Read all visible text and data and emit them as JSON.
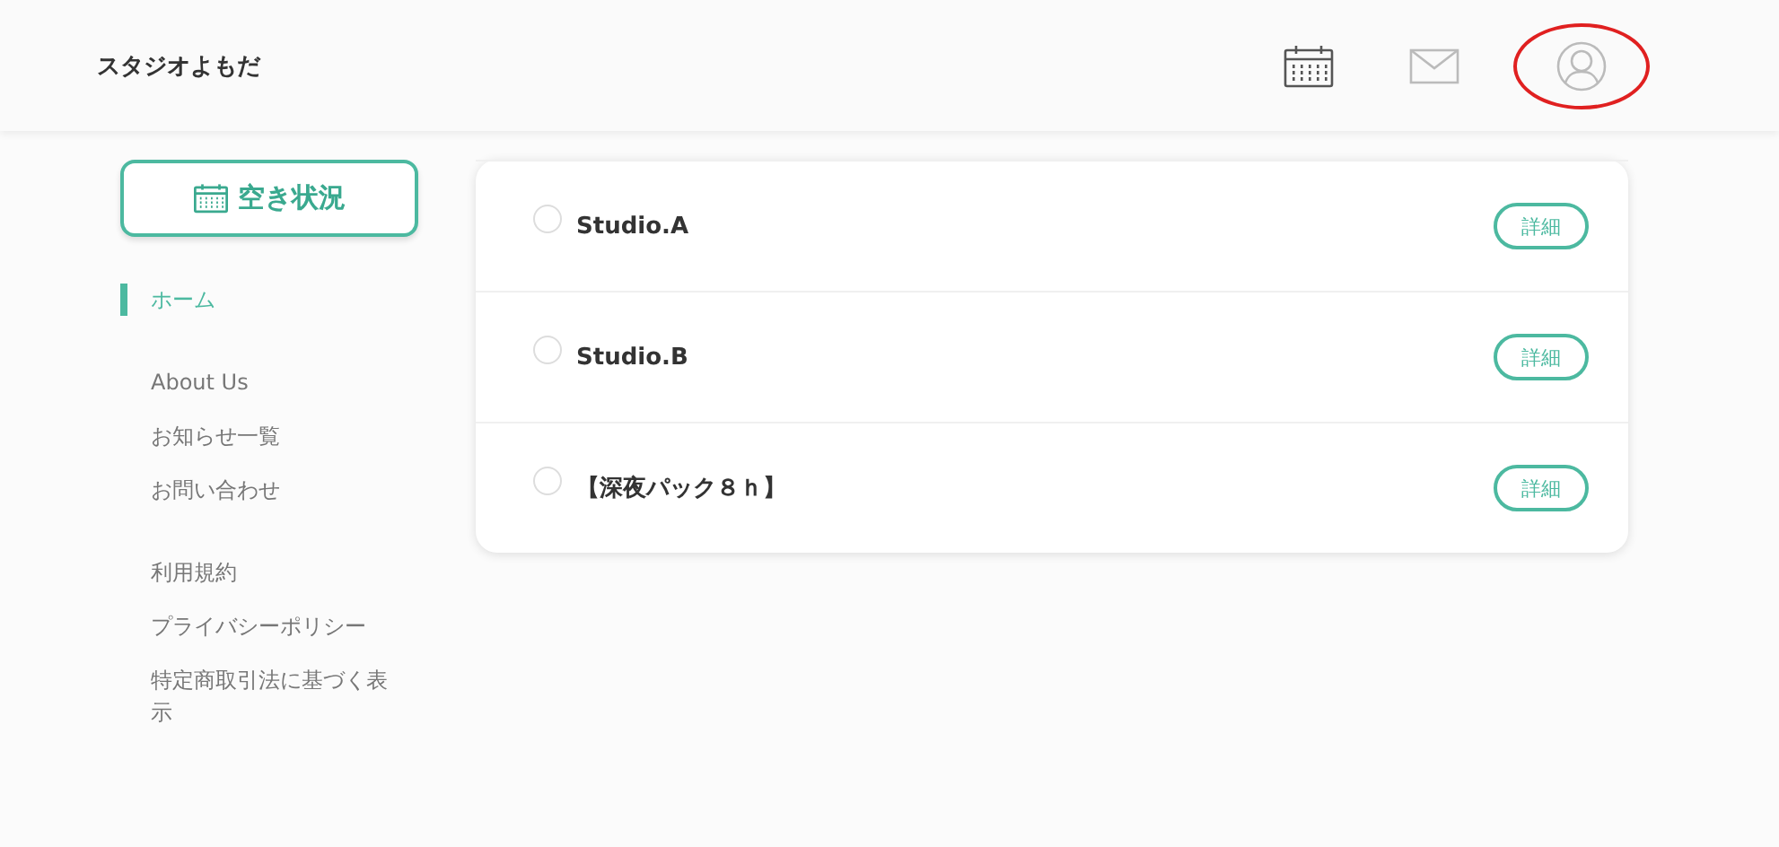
{
  "header": {
    "title": "スタジオよもだ",
    "icons": [
      {
        "kind": "calendar",
        "highlighted": false
      },
      {
        "kind": "mail",
        "highlighted": false
      },
      {
        "kind": "user",
        "highlighted": true
      }
    ]
  },
  "sidebar": {
    "availability_button": "空き状況",
    "nav_groups": [
      [
        {
          "label": "ホーム",
          "selected": true
        }
      ],
      [
        {
          "label": "About Us",
          "selected": false
        },
        {
          "label": "お知らせ一覧",
          "selected": false
        },
        {
          "label": "お問い合わせ",
          "selected": false
        }
      ],
      [
        {
          "label": "利用規約",
          "selected": false
        },
        {
          "label": "プライバシーポリシー",
          "selected": false
        },
        {
          "label": "特定商取引法に基づく表示",
          "selected": false
        }
      ]
    ]
  },
  "studios": [
    {
      "name": "Studio.A",
      "checked": false,
      "button": "詳細"
    },
    {
      "name": "Studio.B",
      "checked": false,
      "button": "詳細"
    },
    {
      "name": "【深夜パック８ｈ】",
      "checked": false,
      "button": "詳細"
    }
  ]
}
